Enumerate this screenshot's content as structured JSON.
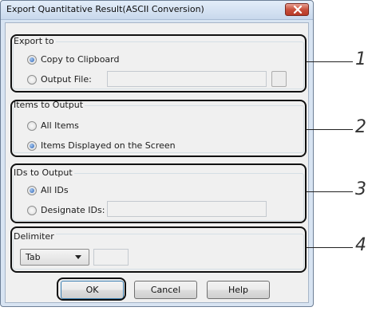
{
  "window": {
    "title": "Export Quantitative Result(ASCII Conversion)"
  },
  "export_to": {
    "legend": "Export to",
    "options": [
      "Copy to Clipboard",
      "Output File:"
    ],
    "selected": "Copy to Clipboard",
    "output_file_value": ""
  },
  "items_to_output": {
    "legend": "Items to Output",
    "options": [
      "All Items",
      "Items Displayed on the Screen"
    ],
    "selected": "Items Displayed on the Screen"
  },
  "ids_to_output": {
    "legend": "IDs to Output",
    "options": [
      "All IDs",
      "Designate IDs:"
    ],
    "selected": "All IDs",
    "designate_value": ""
  },
  "delimiter": {
    "legend": "Delimiter",
    "selected": "Tab",
    "custom_value": ""
  },
  "buttons": {
    "ok": "OK",
    "cancel": "Cancel",
    "help": "Help"
  },
  "callout_numbers": [
    "1",
    "2",
    "3",
    "4"
  ]
}
